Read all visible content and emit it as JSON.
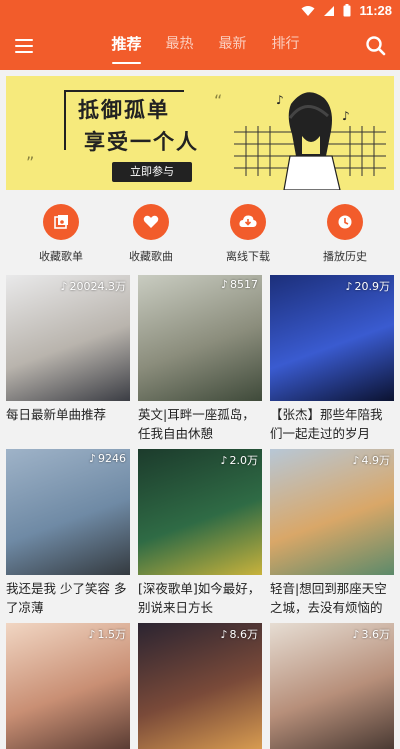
{
  "status": {
    "time": "11:28"
  },
  "tabs": [
    "推荐",
    "最热",
    "最新",
    "排行"
  ],
  "banner": {
    "line1": "抵御孤单",
    "line2": "享受一个人",
    "cta": "立即参与"
  },
  "quick": [
    "收藏歌单",
    "收藏歌曲",
    "离线下载",
    "播放历史"
  ],
  "cards": [
    {
      "plays": "20024.3万",
      "title": "每日最新单曲推荐",
      "cover": [
        "#e9e9ea",
        "#b9b4ad",
        "#3b3d44"
      ]
    },
    {
      "plays": "8517",
      "title": "英文|耳畔一座孤岛，任我自由休憩",
      "cover": [
        "#c9ccc1",
        "#8b8d7c",
        "#3f4a3a"
      ]
    },
    {
      "plays": "20.9万",
      "title": "【张杰】那些年陪我们一起走过的岁月",
      "cover": [
        "#1c2f7a",
        "#3a5bd0",
        "#0b1230"
      ]
    },
    {
      "plays": "9246",
      "title": "我还是我 少了笑容 多了凉薄",
      "cover": [
        "#9fb3c8",
        "#6f8aa5",
        "#343a3f"
      ]
    },
    {
      "plays": "2.0万",
      "title": "[深夜歌单]如今最好，别说来日方长",
      "cover": [
        "#1c3b2c",
        "#2f6b45",
        "#c8b23c"
      ]
    },
    {
      "plays": "4.9万",
      "title": "轻音|想回到那座天空之城，去没有烦恼的",
      "cover": [
        "#b7c7d6",
        "#d9a768",
        "#5c8a6a"
      ]
    },
    {
      "plays": "1.5万",
      "title": "",
      "cover": [
        "#f1d6c3",
        "#c98f74",
        "#5a3c33"
      ]
    },
    {
      "plays": "8.6万",
      "title": "",
      "cover": [
        "#2b2431",
        "#7a4a39",
        "#d79b50"
      ]
    },
    {
      "plays": "3.6万",
      "title": "",
      "cover": [
        "#e6ddd3",
        "#b78f7a",
        "#4a3a33"
      ]
    }
  ],
  "colors": {
    "accent": "#f25c2b",
    "banner": "#f6ea7c"
  }
}
